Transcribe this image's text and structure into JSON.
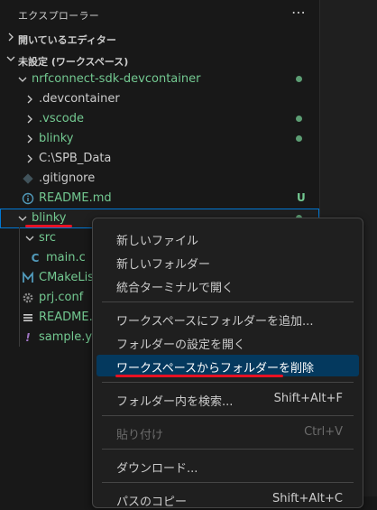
{
  "explorer": {
    "title": "エクスプローラー",
    "more_icon": "more-actions-icon",
    "sections": [
      {
        "label": "開いているエディター",
        "expanded": false
      },
      {
        "label": "未設定 (ワークスペース)",
        "expanded": true
      }
    ],
    "tree": {
      "root": "nrfconnect-sdk-devcontainer",
      "devcontainer": ".devcontainer",
      "vscode": ".vscode",
      "blinky_inner": "blinky",
      "spb": "C:\\SPB_Data",
      "gitignore": ".gitignore",
      "readme": "README.md",
      "readme_badge": "U",
      "blinky": "blinky",
      "src": "src",
      "mainc": "main.c",
      "mainc_icon": "C",
      "cmake": "CMakeLists",
      "prj": "prj.conf",
      "readme2": "README.rs",
      "sample": "sample.yan"
    },
    "colors": {
      "modified_green": "#73c991",
      "selection_blue": "#0078d4",
      "annotation_red": "#e81123"
    }
  },
  "context_menu": {
    "items": [
      {
        "label": "新しいファイル",
        "shortcut": ""
      },
      {
        "label": "新しいフォルダー",
        "shortcut": ""
      },
      {
        "label": "統合ターミナルで開く",
        "shortcut": ""
      },
      {
        "label": "ワークスペースにフォルダーを追加...",
        "shortcut": ""
      },
      {
        "label": "フォルダーの設定を開く",
        "shortcut": ""
      },
      {
        "label": "ワークスペースからフォルダーを削除",
        "shortcut": ""
      },
      {
        "label": "フォルダー内を検索...",
        "shortcut": "Shift+Alt+F"
      },
      {
        "label": "貼り付け",
        "shortcut": "Ctrl+V"
      },
      {
        "label": "ダウンロード...",
        "shortcut": ""
      },
      {
        "label": "パスのコピー",
        "shortcut": "Shift+Alt+C"
      }
    ],
    "highlight_color": "#04395e"
  }
}
